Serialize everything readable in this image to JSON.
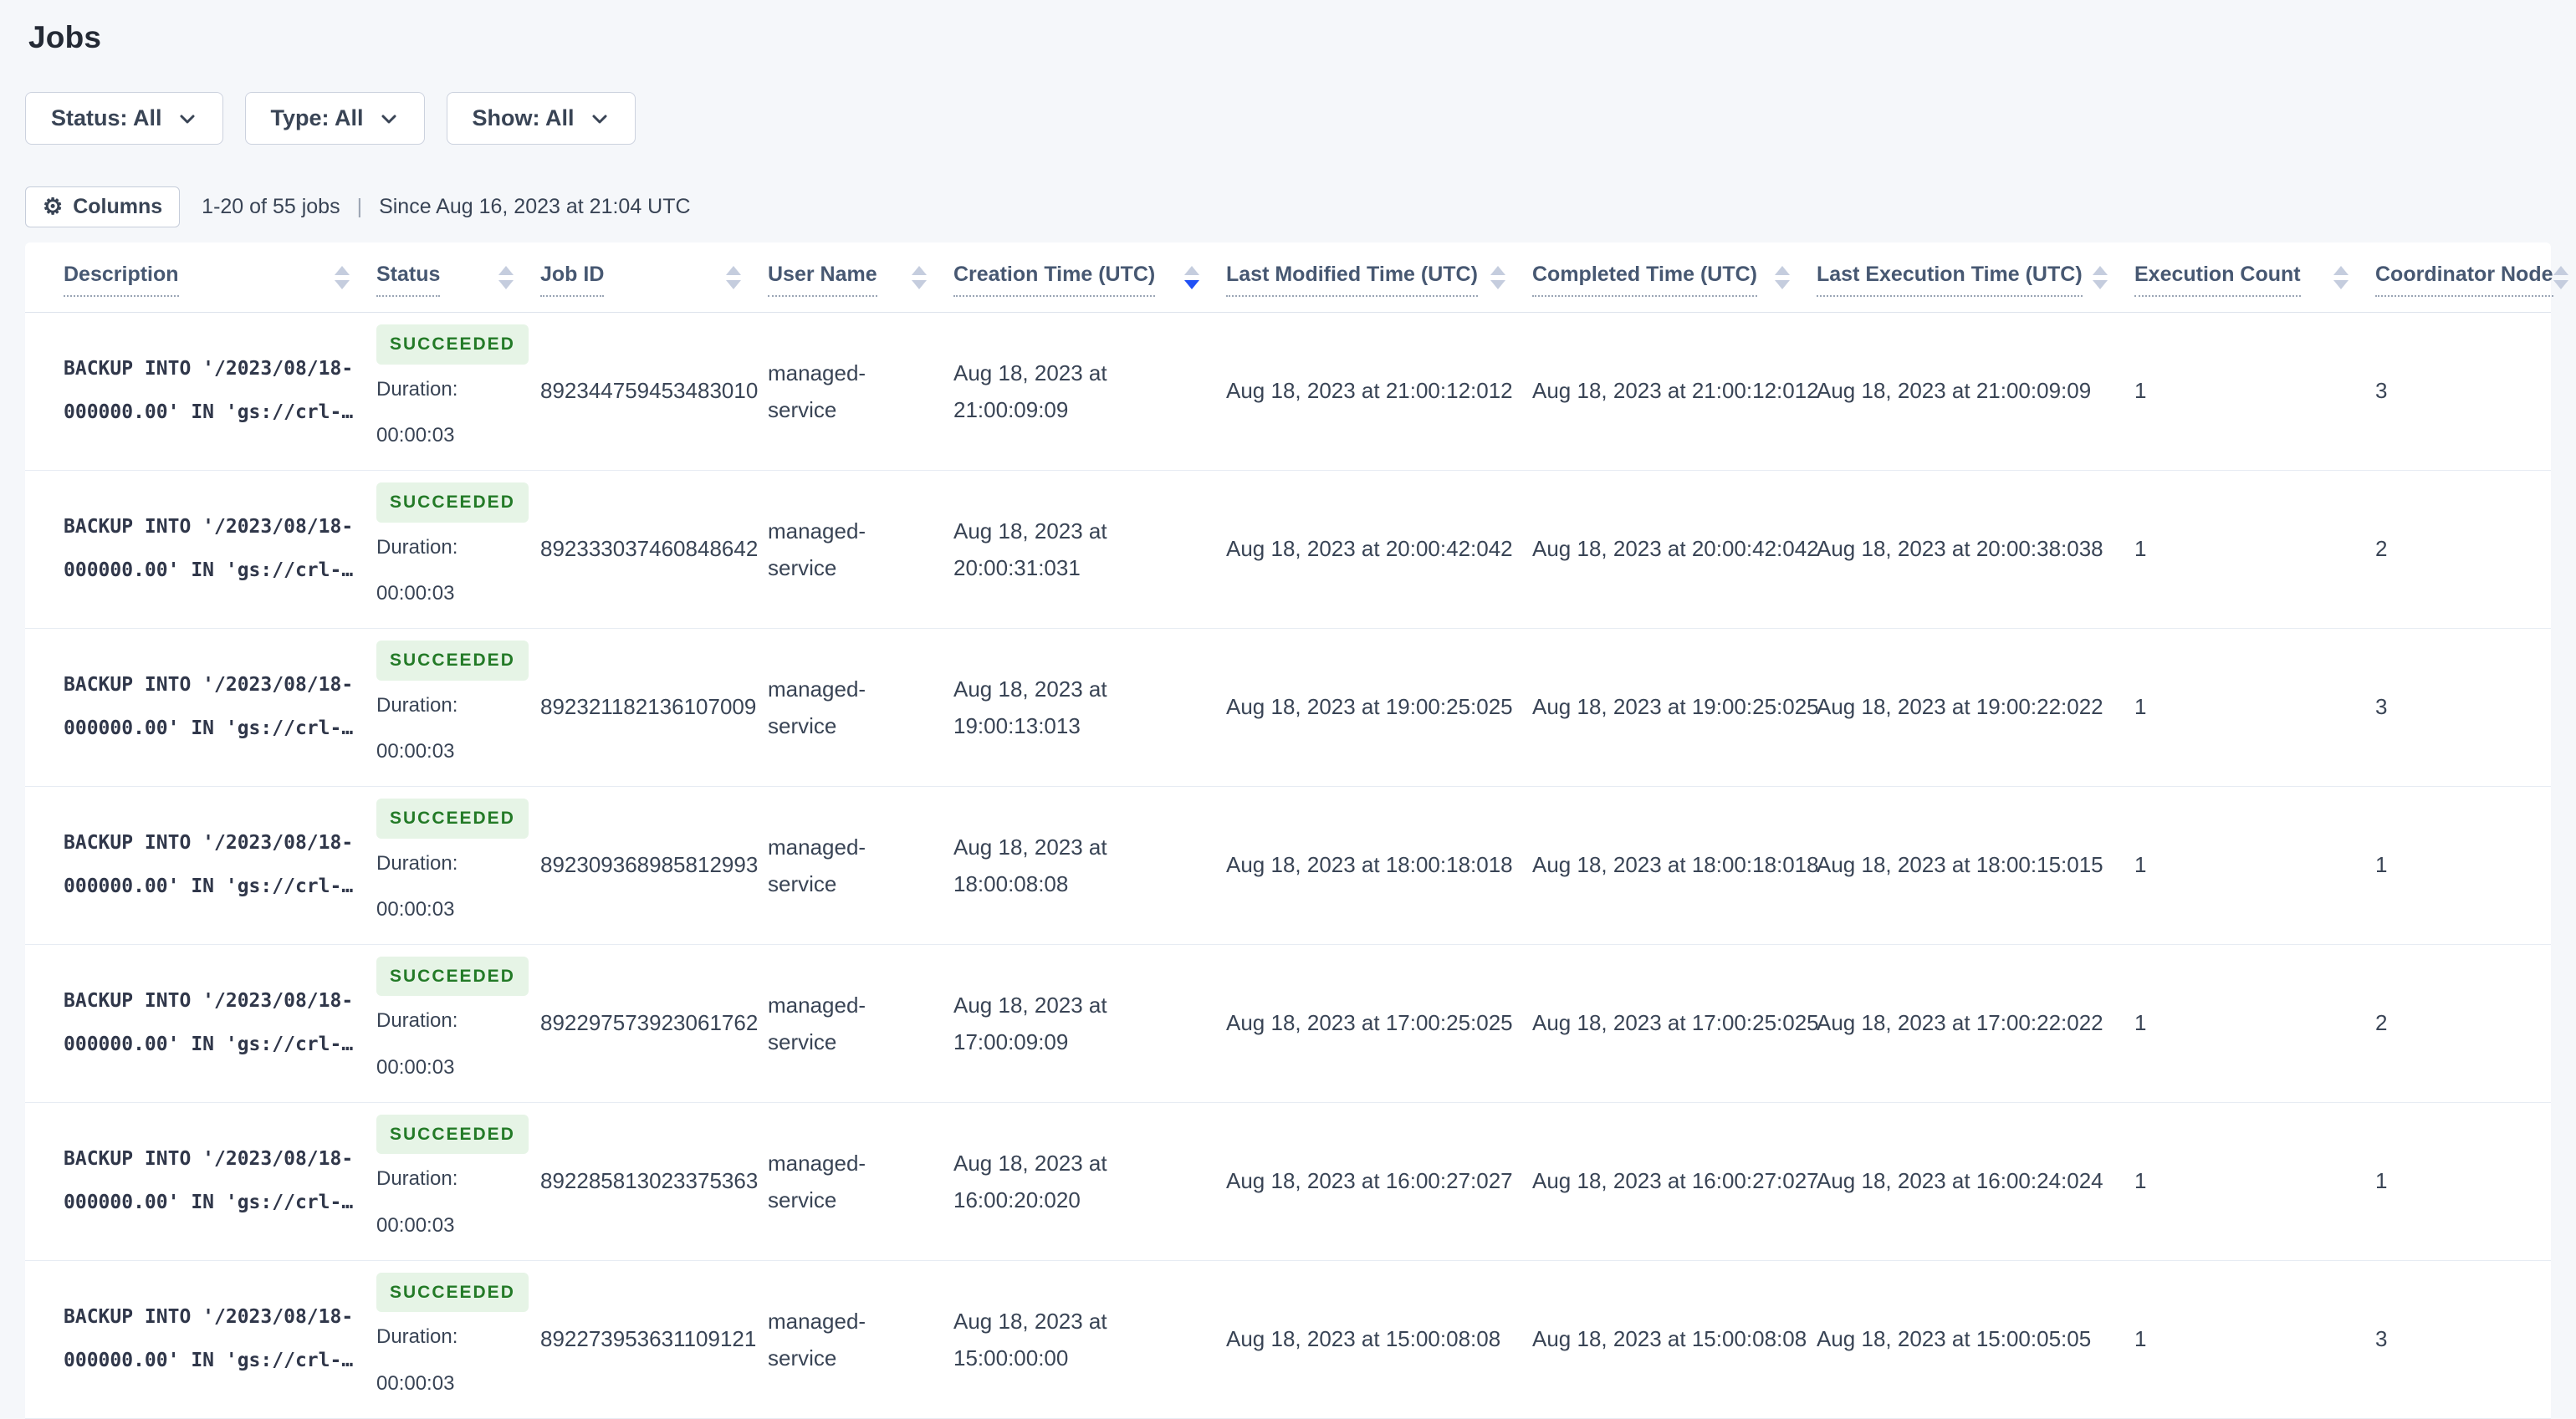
{
  "page": {
    "title": "Jobs"
  },
  "filters": [
    {
      "label": "Status: All"
    },
    {
      "label": "Type: All"
    },
    {
      "label": "Show: All"
    }
  ],
  "toolbar": {
    "columns_button_label": "Columns",
    "gear_icon": "⚙",
    "count_text": "1-20 of 55 jobs",
    "separator": "|",
    "since_text": "Since Aug 16, 2023 at 21:04 UTC"
  },
  "table": {
    "columns": [
      {
        "label": "Description",
        "sort": "none"
      },
      {
        "label": "Status",
        "sort": "none"
      },
      {
        "label": "Job ID",
        "sort": "none"
      },
      {
        "label": "User Name",
        "sort": "none"
      },
      {
        "label": "Creation Time (UTC)",
        "sort": "desc"
      },
      {
        "label": "Last Modified Time (UTC)",
        "sort": "none"
      },
      {
        "label": "Completed Time (UTC)",
        "sort": "none"
      },
      {
        "label": "Last Execution Time (UTC)",
        "sort": "none"
      },
      {
        "label": "Execution Count",
        "sort": "none"
      },
      {
        "label": "Coordinator Node",
        "sort": "none"
      }
    ],
    "rows": [
      {
        "description_line1": "BACKUP INTO '/2023/08/18-",
        "description_line2": "000000.00' IN 'gs://crl-…",
        "status": "SUCCEEDED",
        "duration_label": "Duration:",
        "duration_value": "00:00:03",
        "job_id": "892344759453483010",
        "user_name": "managed-service",
        "creation_time": "Aug 18, 2023 at 21:00:09:09",
        "last_modified_time": "Aug 18, 2023 at 21:00:12:012",
        "completed_time": "Aug 18, 2023 at 21:00:12:012",
        "last_execution_time": "Aug 18, 2023 at 21:00:09:09",
        "execution_count": "1",
        "coordinator_node": "3"
      },
      {
        "description_line1": "BACKUP INTO '/2023/08/18-",
        "description_line2": "000000.00' IN 'gs://crl-…",
        "status": "SUCCEEDED",
        "duration_label": "Duration:",
        "duration_value": "00:00:03",
        "job_id": "892333037460848642",
        "user_name": "managed-service",
        "creation_time": "Aug 18, 2023 at 20:00:31:031",
        "last_modified_time": "Aug 18, 2023 at 20:00:42:042",
        "completed_time": "Aug 18, 2023 at 20:00:42:042",
        "last_execution_time": "Aug 18, 2023 at 20:00:38:038",
        "execution_count": "1",
        "coordinator_node": "2"
      },
      {
        "description_line1": "BACKUP INTO '/2023/08/18-",
        "description_line2": "000000.00' IN 'gs://crl-…",
        "status": "SUCCEEDED",
        "duration_label": "Duration:",
        "duration_value": "00:00:03",
        "job_id": "892321182136107009",
        "user_name": "managed-service",
        "creation_time": "Aug 18, 2023 at 19:00:13:013",
        "last_modified_time": "Aug 18, 2023 at 19:00:25:025",
        "completed_time": "Aug 18, 2023 at 19:00:25:025",
        "last_execution_time": "Aug 18, 2023 at 19:00:22:022",
        "execution_count": "1",
        "coordinator_node": "3"
      },
      {
        "description_line1": "BACKUP INTO '/2023/08/18-",
        "description_line2": "000000.00' IN 'gs://crl-…",
        "status": "SUCCEEDED",
        "duration_label": "Duration:",
        "duration_value": "00:00:03",
        "job_id": "892309368985812993",
        "user_name": "managed-service",
        "creation_time": "Aug 18, 2023 at 18:00:08:08",
        "last_modified_time": "Aug 18, 2023 at 18:00:18:018",
        "completed_time": "Aug 18, 2023 at 18:00:18:018",
        "last_execution_time": "Aug 18, 2023 at 18:00:15:015",
        "execution_count": "1",
        "coordinator_node": "1"
      },
      {
        "description_line1": "BACKUP INTO '/2023/08/18-",
        "description_line2": "000000.00' IN 'gs://crl-…",
        "status": "SUCCEEDED",
        "duration_label": "Duration:",
        "duration_value": "00:00:03",
        "job_id": "892297573923061762",
        "user_name": "managed-service",
        "creation_time": "Aug 18, 2023 at 17:00:09:09",
        "last_modified_time": "Aug 18, 2023 at 17:00:25:025",
        "completed_time": "Aug 18, 2023 at 17:00:25:025",
        "last_execution_time": "Aug 18, 2023 at 17:00:22:022",
        "execution_count": "1",
        "coordinator_node": "2"
      },
      {
        "description_line1": "BACKUP INTO '/2023/08/18-",
        "description_line2": "000000.00' IN 'gs://crl-…",
        "status": "SUCCEEDED",
        "duration_label": "Duration:",
        "duration_value": "00:00:03",
        "job_id": "892285813023375363",
        "user_name": "managed-service",
        "creation_time": "Aug 18, 2023 at 16:00:20:020",
        "last_modified_time": "Aug 18, 2023 at 16:00:27:027",
        "completed_time": "Aug 18, 2023 at 16:00:27:027",
        "last_execution_time": "Aug 18, 2023 at 16:00:24:024",
        "execution_count": "1",
        "coordinator_node": "1"
      },
      {
        "description_line1": "BACKUP INTO '/2023/08/18-",
        "description_line2": "000000.00' IN 'gs://crl-…",
        "status": "SUCCEEDED",
        "duration_label": "Duration:",
        "duration_value": "00:00:03",
        "job_id": "892273953631109121",
        "user_name": "managed-service",
        "creation_time": "Aug 18, 2023 at 15:00:00:00",
        "last_modified_time": "Aug 18, 2023 at 15:00:08:08",
        "completed_time": "Aug 18, 2023 at 15:00:08:08",
        "last_execution_time": "Aug 18, 2023 at 15:00:05:05",
        "execution_count": "1",
        "coordinator_node": "3"
      }
    ]
  },
  "colors": {
    "accent_sort_active": "#2151f5",
    "badge_bg": "#e6f4e6",
    "badge_text": "#237a27",
    "page_bg": "#f5f7fa"
  }
}
